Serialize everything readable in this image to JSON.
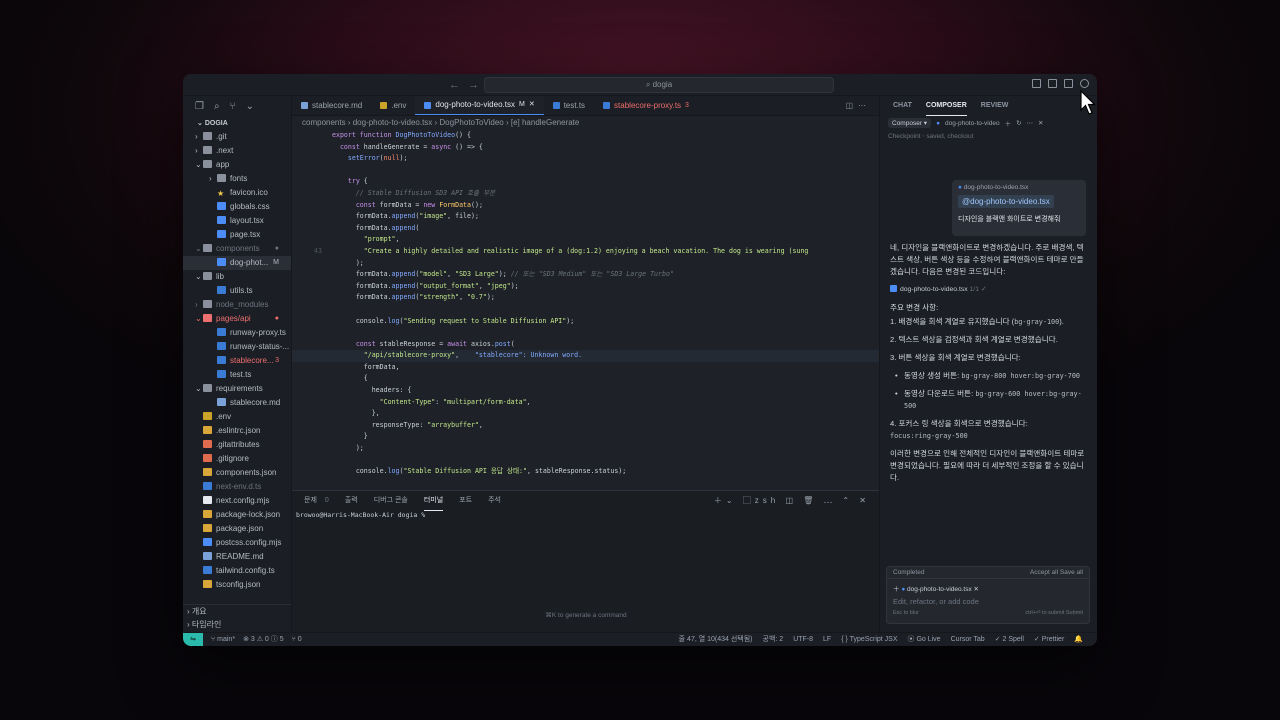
{
  "titlebar": {
    "search": "dogia",
    "back": "←",
    "forward": "→"
  },
  "explorer": {
    "root": "DOGIA",
    "items": [
      {
        "label": ".git",
        "depth": 1,
        "kind": "folder"
      },
      {
        "label": ".next",
        "depth": 1,
        "kind": "folder"
      },
      {
        "label": "app",
        "depth": 1,
        "kind": "folder-open"
      },
      {
        "label": "fonts",
        "depth": 2,
        "kind": "folder"
      },
      {
        "label": "favicon.ico",
        "depth": 2,
        "kind": "star"
      },
      {
        "label": "globals.css",
        "depth": 2,
        "kind": "css"
      },
      {
        "label": "layout.tsx",
        "depth": 2,
        "kind": "tsx"
      },
      {
        "label": "page.tsx",
        "depth": 2,
        "kind": "tsx"
      },
      {
        "label": "components",
        "depth": 1,
        "kind": "folder-open",
        "dim": true,
        "badge": "●"
      },
      {
        "label": "dog-phot...",
        "depth": 2,
        "kind": "tsx",
        "badge": "M",
        "selected": true
      },
      {
        "label": "lib",
        "depth": 1,
        "kind": "folder-open"
      },
      {
        "label": "utils.ts",
        "depth": 2,
        "kind": "ts"
      },
      {
        "label": "node_modules",
        "depth": 1,
        "kind": "folder",
        "dim": true
      },
      {
        "label": "pages/api",
        "depth": 1,
        "kind": "folder-open",
        "error": true,
        "badge": "●"
      },
      {
        "label": "runway-proxy.ts",
        "depth": 2,
        "kind": "ts"
      },
      {
        "label": "runway-status-...",
        "depth": 2,
        "kind": "ts"
      },
      {
        "label": "stablecore...",
        "depth": 2,
        "kind": "ts",
        "error": true,
        "badge": "3"
      },
      {
        "label": "test.ts",
        "depth": 2,
        "kind": "ts"
      },
      {
        "label": "requirements",
        "depth": 1,
        "kind": "folder-open"
      },
      {
        "label": "stablecore.md",
        "depth": 2,
        "kind": "md"
      },
      {
        "label": ".env",
        "depth": 1,
        "kind": "env"
      },
      {
        "label": ".eslintrc.json",
        "depth": 1,
        "kind": "json"
      },
      {
        "label": ".gitattributes",
        "depth": 1,
        "kind": "git"
      },
      {
        "label": ".gitignore",
        "depth": 1,
        "kind": "git"
      },
      {
        "label": "components.json",
        "depth": 1,
        "kind": "json"
      },
      {
        "label": "next-env.d.ts",
        "depth": 1,
        "kind": "ts",
        "dim": true
      },
      {
        "label": "next.config.mjs",
        "depth": 1,
        "kind": "next"
      },
      {
        "label": "package-lock.json",
        "depth": 1,
        "kind": "json"
      },
      {
        "label": "package.json",
        "depth": 1,
        "kind": "json"
      },
      {
        "label": "postcss.config.mjs",
        "depth": 1,
        "kind": "css"
      },
      {
        "label": "README.md",
        "depth": 1,
        "kind": "md"
      },
      {
        "label": "tailwind.config.ts",
        "depth": 1,
        "kind": "ts"
      },
      {
        "label": "tsconfig.json",
        "depth": 1,
        "kind": "json"
      }
    ],
    "outline": "개요",
    "timeline": "타임라인"
  },
  "tabs": [
    {
      "label": "stablecore.md",
      "kind": "md"
    },
    {
      "label": ".env",
      "kind": "env"
    },
    {
      "label": "dog-photo-to-video.tsx",
      "suffix": "M",
      "active": true,
      "kind": "tsx"
    },
    {
      "label": "test.ts",
      "kind": "ts"
    },
    {
      "label": "stablecore-proxy.ts",
      "suffix": "3",
      "error": true,
      "kind": "ts"
    }
  ],
  "breadcrumb": "components  ›  dog-photo-to-video.tsx  ›  DogPhotoToVideo  ›  [e] handleGenerate",
  "code": [
    {
      "ln": "",
      "html": "<span class='kw'>export function</span> <span class='fn'>DogPhotoToVideo</span>() {"
    },
    {
      "ln": "",
      "html": "  <span class='kw'>const</span> handleGenerate = <span class='kw'>async</span> () => {"
    },
    {
      "ln": "",
      "html": "    <span class='fn'>setError</span>(<span class='pr'>null</span>);"
    },
    {
      "ln": "",
      "html": ""
    },
    {
      "ln": "",
      "html": "    <span class='kw'>try</span> {"
    },
    {
      "ln": "",
      "html": "      <span class='cm'>// Stable Diffusion SD3 API 호출 부분</span>"
    },
    {
      "ln": "",
      "html": "      <span class='kw'>const</span> formData = <span class='kw'>new</span> <span class='ty'>FormData</span>();"
    },
    {
      "ln": "",
      "html": "      formData.<span class='fn'>append</span>(<span class='st'>\"image\"</span>, file);"
    },
    {
      "ln": "",
      "html": "      formData.<span class='fn'>append</span>("
    },
    {
      "ln": "",
      "html": "        <span class='st'>\"prompt\"</span>,"
    },
    {
      "ln": "43",
      "html": "        <span class='st'>\"Create a highly detailed and realistic image of a (dog:1.2) enjoying a beach vacation. The dog is wearing (sung</span>"
    },
    {
      "ln": "",
      "html": "      );"
    },
    {
      "ln": "",
      "html": "      formData.<span class='fn'>append</span>(<span class='st'>\"model\"</span>, <span class='st'>\"SD3 Large\"</span>); <span class='cm'>// 또는 \"SD3 Medium\" 또는 \"SD3 Large Turbo\"</span>"
    },
    {
      "ln": "",
      "html": "      formData.<span class='fn'>append</span>(<span class='st'>\"output_format\"</span>, <span class='st'>\"jpeg\"</span>);"
    },
    {
      "ln": "",
      "html": "      formData.<span class='fn'>append</span>(<span class='st'>\"strength\"</span>, <span class='st'>\"0.7\"</span>);"
    },
    {
      "ln": "",
      "html": ""
    },
    {
      "ln": "",
      "html": "      console.<span class='fn'>log</span>(<span class='st'>\"Sending request to Stable Diffusion API\"</span>);"
    },
    {
      "ln": "",
      "html": ""
    },
    {
      "ln": "",
      "html": "      <span class='kw'>const</span> stableResponse = <span class='kw'>await</span> axios.<span class='fn'>post</span>("
    },
    {
      "ln": "",
      "html": "        <span class='st'>\"/api/stablecore-proxy\"</span>,    <span class='fn'>\"stablecore\": Unknown word.</span>",
      "hl": true
    },
    {
      "ln": "",
      "html": "        formData,"
    },
    {
      "ln": "",
      "html": "        {"
    },
    {
      "ln": "",
      "html": "          headers: {"
    },
    {
      "ln": "",
      "html": "            <span class='st'>\"Content-Type\"</span>: <span class='st'>\"multipart/form-data\"</span>,"
    },
    {
      "ln": "",
      "html": "          },"
    },
    {
      "ln": "",
      "html": "          responseType: <span class='st'>\"arraybuffer\"</span>,"
    },
    {
      "ln": "",
      "html": "        }"
    },
    {
      "ln": "",
      "html": "      );"
    },
    {
      "ln": "",
      "html": ""
    },
    {
      "ln": "",
      "html": "      console.<span class='fn'>log</span>(<span class='st'>\"Stable Diffusion API 응답 상태:\"</span>, stableResponse.status);"
    }
  ],
  "panel": {
    "tabs": [
      "문제",
      "출력",
      "디버그 콘솔",
      "터미널",
      "포트",
      "주석"
    ],
    "problem_count": "0",
    "active": "터미널",
    "shell": "zsh",
    "prompt": "browoo@Harris-MacBook-Air dogia %"
  },
  "editor_hint": "⌘K to generate a command",
  "chat": {
    "tabs": [
      "CHAT",
      "COMPOSER",
      "REVIEW"
    ],
    "active": "COMPOSER",
    "mode": "Composer ▾",
    "context_file": "dog-photo-to-video",
    "checkpoint": "Checkpoint  ◦  saved,  checkout",
    "user_file": "dog-photo-to-video.tsx",
    "user_mention": "@dog-photo-to-video.tsx",
    "user_message": "디자인을 블랙앤 화이트로 변경해줘",
    "reply_intro": "네, 디자인을 블랙앤화이트로 변경하겠습니다. 주로 배경색, 텍스트 색상, 버튼 색상 등을 수정하여 블랙앤화이트 테마로 만들겠습니다. 다음은 변경된 코드입니다:",
    "reply_file": "dog-photo-to-video.tsx",
    "reply_file_meta": "1/1  ✓",
    "changes_title": "주요 변경 사항:",
    "change1": "1. 배경색을 회색 계열로 유지했습니다 (",
    "change1_code": "bg-gray-100",
    "change1_end": ").",
    "change2": "2. 텍스트 색상을 검정색과 회색 계열로 변경했습니다.",
    "change3": "3. 버튼 색상을 회색 계열로 변경했습니다:",
    "bullet1": "동영상 생성 버튼:",
    "bullet1_code": "bg-gray-800 hover:bg-gray-700",
    "bullet2": "동영상 다운로드 버튼:",
    "bullet2_code": "bg-gray-600 hover:bg-gray-500",
    "change4": "4. 포커스 링 색상을 회색으로 변경했습니다:",
    "change4_code": "focus:ring-gray-500",
    "summary": "이러한 변경으로 인해 전체적인 디자인이 블랙앤화이트 테마로 변경되었습니다. 필요에 따라 더 세부적인 조정을 할 수 있습니다.",
    "completed": "Completed",
    "accept_all": "Accept all",
    "save_all": "Save all",
    "input_file": "dog-photo-to-video.tsx",
    "input_placeholder": "Edit, refactor, or add code",
    "input_hint": "Esc to blur",
    "input_hint_right": "ctrl+⏎ to submit   Submit"
  },
  "status": {
    "branch": "main*",
    "errors": "⊗ 3 ⚠ 0 ⓘ 5",
    "ports": "⑂ 0",
    "position": "줄 47, 열 10(434 선택됨)",
    "spaces": "공백: 2",
    "encoding": "UTF-8",
    "eol": "LF",
    "language": "{ } TypeScript JSX",
    "golive": "Go Live",
    "cursor_tab": "Cursor Tab",
    "spell": "2 Spell",
    "prettier": "✓ Prettier"
  },
  "colors": {
    "accent": "#4c8cf5",
    "error": "#ee6f6f",
    "remote": "#2bbbad"
  }
}
